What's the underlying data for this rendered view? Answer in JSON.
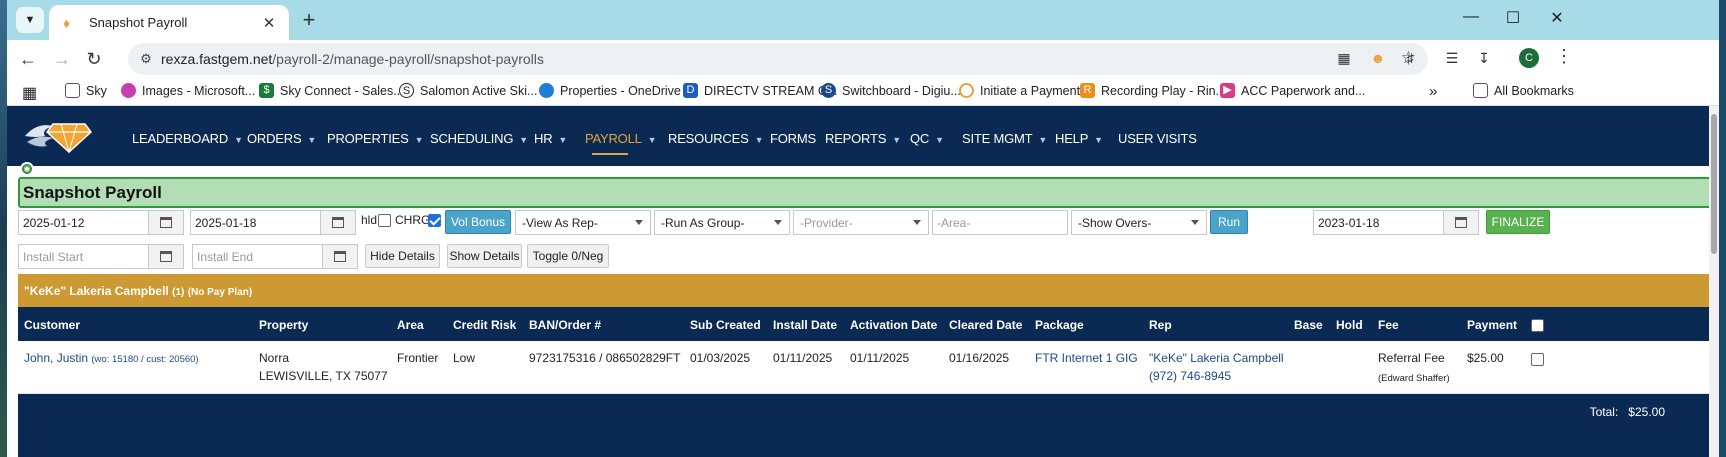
{
  "browser": {
    "tab_title": "Snapshot Payroll",
    "url_domain": "rexza.fastgem.net",
    "url_path": "/payroll-2/manage-payroll/snapshot-payrolls",
    "profile_initial": "C",
    "bookmarks": [
      {
        "label": "Sky",
        "icon": "folder-icon"
      },
      {
        "label": "Images - Microsoft...",
        "icon": "copilot-icon"
      },
      {
        "label": "Sky Connect - Sales...",
        "icon": "dollar-icon"
      },
      {
        "label": "Salomon Active Ski...",
        "icon": "salomon-icon"
      },
      {
        "label": "Properties - OneDrive",
        "icon": "onedrive-icon"
      },
      {
        "label": "DIRECTV STREAM C...",
        "icon": "directv-icon"
      },
      {
        "label": "Switchboard - Digiu...",
        "icon": "switchboard-icon"
      },
      {
        "label": "Initiate a Payment",
        "icon": "payment-icon"
      },
      {
        "label": "Recording Play - Rin...",
        "icon": "ringcentral-icon"
      },
      {
        "label": "ACC Paperwork and...",
        "icon": "acc-icon"
      }
    ],
    "overflow_label": "»",
    "all_bookmarks": "All Bookmarks"
  },
  "nav": {
    "items": [
      {
        "label": "LEADERBOARD",
        "has_menu": true
      },
      {
        "label": "ORDERS",
        "has_menu": true
      },
      {
        "label": "PROPERTIES",
        "has_menu": true
      },
      {
        "label": "SCHEDULING",
        "has_menu": true
      },
      {
        "label": "HR",
        "has_menu": true
      },
      {
        "label": "PAYROLL",
        "has_menu": true,
        "active": true
      },
      {
        "label": "RESOURCES",
        "has_menu": true
      },
      {
        "label": "FORMS",
        "has_menu": false
      },
      {
        "label": "REPORTS",
        "has_menu": true
      },
      {
        "label": "QC",
        "has_menu": true
      },
      {
        "label": "SITE MGMT",
        "has_menu": true
      },
      {
        "label": "HELP",
        "has_menu": true
      },
      {
        "label": "USER VISITS",
        "has_menu": false
      }
    ],
    "active_color": "#e8a23a"
  },
  "page": {
    "title": "Snapshot Payroll"
  },
  "filters": {
    "start_date": "2025-01-12",
    "end_date": "2025-01-18",
    "hld_label": "hld",
    "hld_checked": false,
    "chrg_label": "CHRG",
    "chrg_checked": true,
    "vol_bonus_label": "Vol Bonus",
    "view_as_rep": "-View As Rep-",
    "run_as_group": "-Run As Group-",
    "provider": "-Provider-",
    "area_placeholder": "-Area-",
    "show_overs": "-Show Overs-",
    "run_label": "Run",
    "finalize_date": "2023-01-18",
    "finalize_label": "FINALIZE",
    "install_start_placeholder": "Install Start",
    "install_end_placeholder": "Install End",
    "hide_details_label": "Hide Details",
    "show_details_label": "Show Details",
    "toggle_label": "Toggle 0/Neg"
  },
  "rep_group": {
    "name": "\"KeKe\" Lakeria Campbell",
    "count": "(1)",
    "plan": "(No Pay Plan)",
    "band_color": "#cc9933"
  },
  "table": {
    "columns": [
      "Customer",
      "Property",
      "Area",
      "Credit Risk",
      "BAN/Order #",
      "Sub Created",
      "Install Date",
      "Activation Date",
      "Cleared Date",
      "Package",
      "Rep",
      "Base",
      "Hold",
      "Fee",
      "Payment"
    ],
    "rows": [
      {
        "customer": "John, Justin",
        "customer_ids": "(wo: 15180 / cust: 20560)",
        "property_name": "Norra",
        "property_city": "LEWISVILLE, TX 75077",
        "area": "Frontier",
        "credit_risk": "Low",
        "ban_order": "9723175316 / 086502829FT",
        "sub_created": "01/03/2025",
        "install_date": "01/11/2025",
        "activation_date": "01/11/2025",
        "cleared_date": "01/16/2025",
        "package": "FTR Internet 1 GIG",
        "rep_name": "\"KeKe\" Lakeria Campbell",
        "rep_phone": "(972) 746-8945",
        "base": "",
        "hold": "",
        "fee": "Referral Fee",
        "fee_note": "(Edward Shaffer)",
        "payment": "$25.00",
        "checked": false
      }
    ],
    "total_label": "Total:",
    "total_value": "$25.00",
    "header_color": "#0b2a53"
  }
}
